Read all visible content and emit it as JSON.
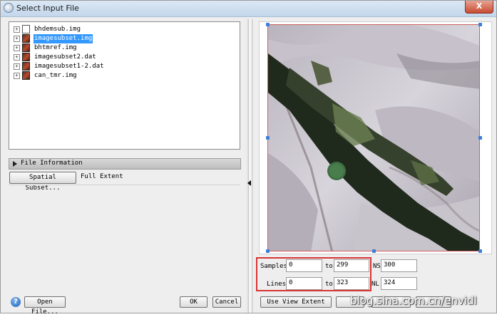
{
  "window": {
    "title": "Select Input File",
    "close_label": "X"
  },
  "file_list": [
    {
      "name": "bhdemsub.img",
      "selected": false,
      "icon": "file-icon"
    },
    {
      "name": "imagesubset.img",
      "selected": true,
      "icon": "image-file-icon"
    },
    {
      "name": "bhtmref.img",
      "selected": false,
      "icon": "image-file-icon"
    },
    {
      "name": "imagesubset2.dat",
      "selected": false,
      "icon": "image-file-icon"
    },
    {
      "name": "imagesubset1-2.dat",
      "selected": false,
      "icon": "image-file-icon"
    },
    {
      "name": "can_tmr.img",
      "selected": false,
      "icon": "image-file-icon"
    }
  ],
  "file_info": {
    "label": "File Information"
  },
  "spatial_subset": {
    "button_label": "Spatial Subset...",
    "value": "Full Extent"
  },
  "buttons": {
    "open_file": "Open File...",
    "ok": "OK",
    "cancel": "Cancel",
    "use_view_extent": "Use View Extent"
  },
  "subset": {
    "samples_label": "Samples",
    "samples_from": "0",
    "samples_to": "299",
    "lines_label": "Lines",
    "lines_from": "0",
    "lines_to": "323",
    "to_label": "to",
    "ns_label": "NS",
    "ns_value": "300",
    "nl_label": "NL",
    "nl_value": "324"
  },
  "watermark": "blog.sina.com.cn/envidl",
  "colors": {
    "selection": "#3399ff",
    "highlight_box": "#d93434",
    "handle": "#3a7fd9"
  }
}
